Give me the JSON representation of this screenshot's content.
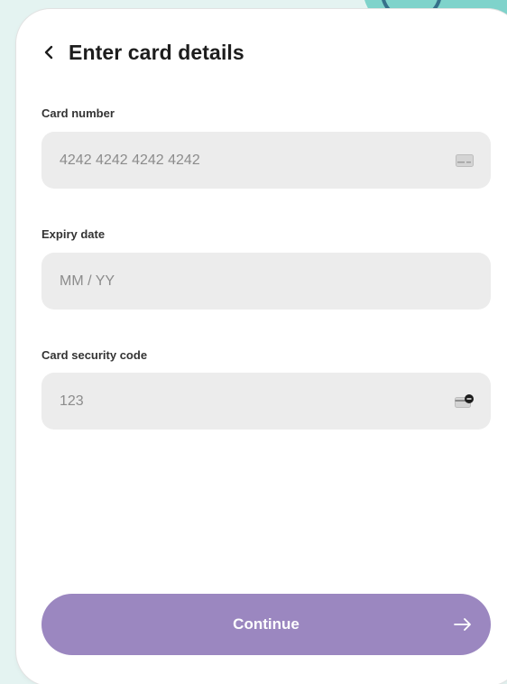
{
  "header": {
    "title": "Enter card details",
    "back_icon": "chevron-left-icon"
  },
  "fields": {
    "card_number": {
      "label": "Card number",
      "placeholder": "4242 4242 4242 4242",
      "value": "",
      "icon": "credit-card-icon"
    },
    "expiry": {
      "label": "Expiry date",
      "placeholder": "MM / YY",
      "value": ""
    },
    "cvc": {
      "label": "Card security code",
      "placeholder": "123",
      "value": "",
      "icon": "card-cvc-icon"
    }
  },
  "continue_button": {
    "label": "Continue",
    "icon": "arrow-right-icon"
  },
  "colors": {
    "accent": "#9b87c0",
    "field_background": "#ececec",
    "page_background": "#e4f3f1",
    "card_background": "#ffffff",
    "text": "#1d1d1d",
    "placeholder": "#8c8c8c"
  }
}
